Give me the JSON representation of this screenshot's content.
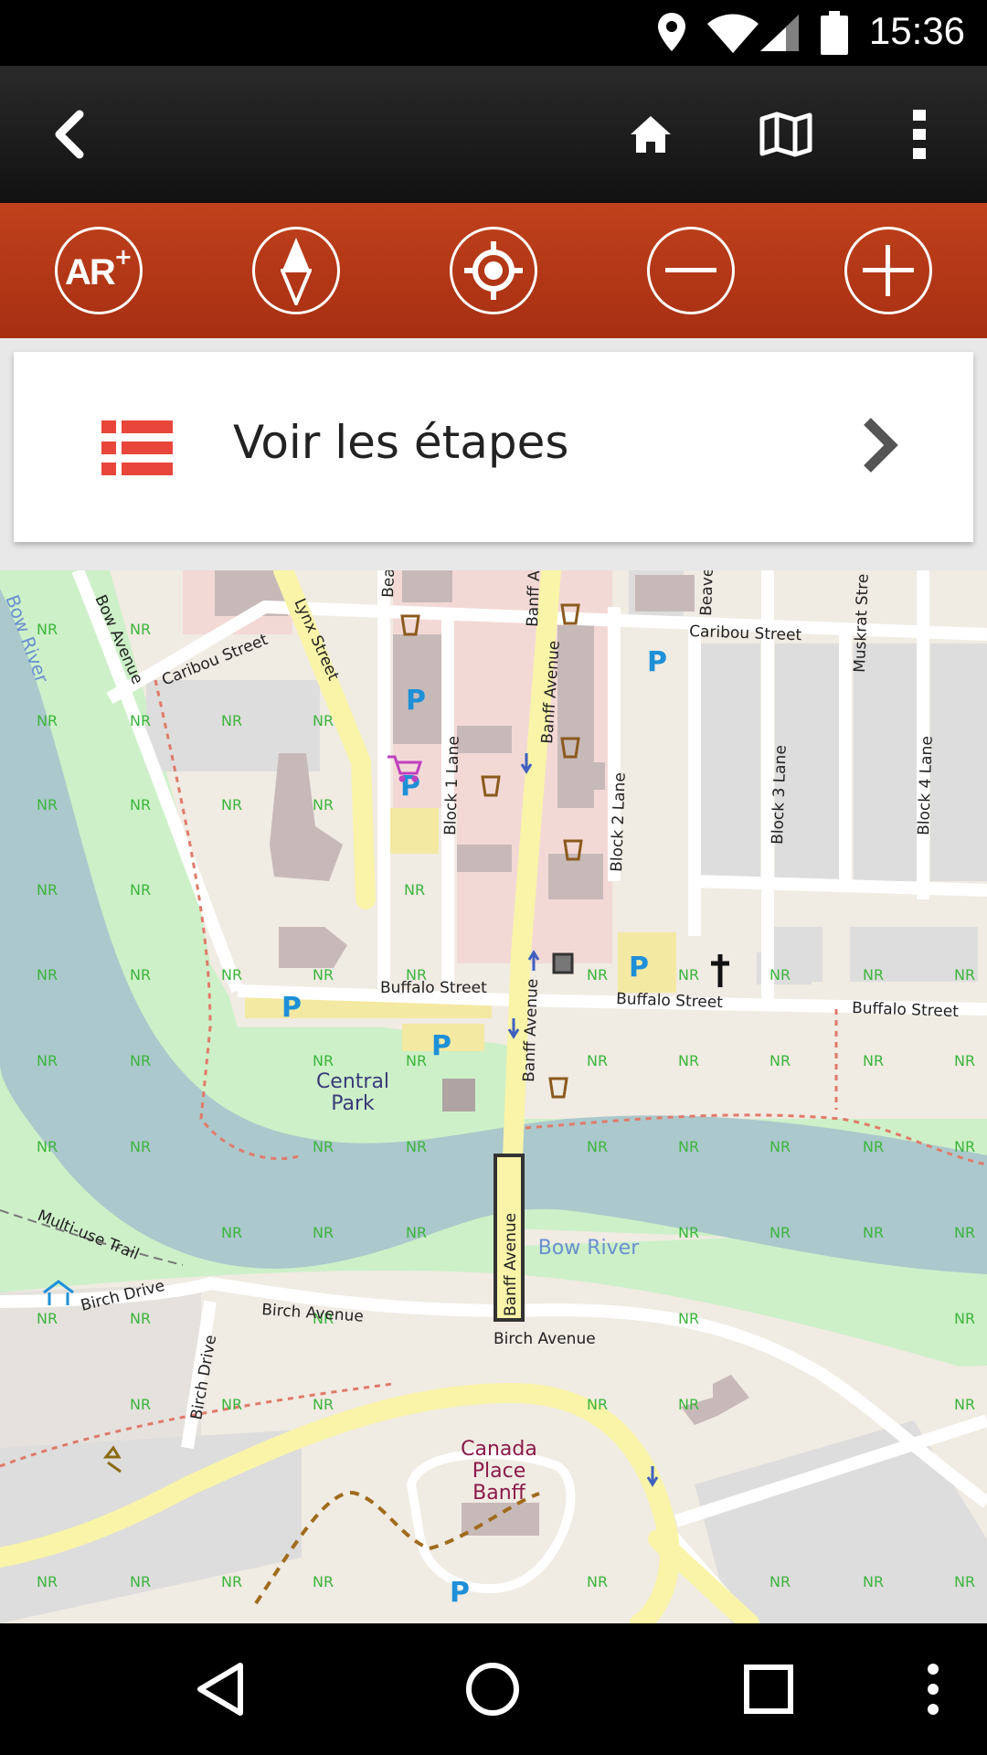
{
  "status_bar": {
    "time": "15:36",
    "icons": [
      "location-icon",
      "wifi-icon",
      "cell-signal-icon",
      "battery-icon"
    ]
  },
  "app_bar": {
    "buttons": [
      "back-icon",
      "home-icon",
      "map-icon",
      "overflow-menu-icon"
    ]
  },
  "toolbar": {
    "ar_label": "AR",
    "buttons": [
      "ar-button",
      "compass-button",
      "locate-button",
      "zoom-out-button",
      "zoom-in-button"
    ],
    "accent": "#b6381a"
  },
  "steps_card": {
    "label": "Voir les étapes",
    "icon": "list-icon",
    "icon_color": "#e8463a"
  },
  "map": {
    "labels": {
      "caribou_street_w": "Caribou Street",
      "caribou_street_e": "Caribou Street",
      "bow_avenue": "Bow Avenue",
      "lynx_street": "Lynx Street",
      "banff_avenue_n": "Banff Avenue",
      "banff_avenue_c": "Banff Avenue",
      "banff_avenue_s": "Banff Avenue",
      "block1_lane": "Block 1 Lane",
      "block2_lane": "Block 2 Lane",
      "block3_lane": "Block 3 Lane",
      "block4_lane": "Block 4 Lane",
      "muskrat_street": "Muskrat Stre",
      "beaver_street": "Beave",
      "bear_street": "Bea",
      "buffalo_street_w": "Buffalo Street",
      "buffalo_street_c": "Buffalo Street",
      "buffalo_street_e": "Buffalo Street",
      "central_park_1": "Central",
      "central_park_2": "Park",
      "bow_river_w": "Bow River",
      "bow_river_c": "Bow River",
      "multi_use_trail": "Multi-use Trail",
      "birch_drive_w": "Birch Drive",
      "birch_drive_s": "Birch Drive",
      "birch_avenue_w": "Birch Avenue",
      "birch_avenue_e": "Birch Avenue",
      "canada_place_1": "Canada",
      "canada_place_2": "Place",
      "canada_place_3": "Banff",
      "nr": "NR",
      "parking": "P"
    },
    "colors": {
      "land": "#f0ebe3",
      "park": "#cdf0c8",
      "water": "#abc8cc",
      "road": "#ffffff",
      "major_road": "#f9f4a8",
      "building": "#c8b9b9",
      "commercial": "#f3d9d6",
      "nr_text": "#3cb53c",
      "parking_text": "#1e90d8"
    }
  },
  "nav_bar": {
    "buttons": [
      "back-nav-icon",
      "home-nav-icon",
      "recents-nav-icon",
      "nav-menu-icon"
    ]
  }
}
